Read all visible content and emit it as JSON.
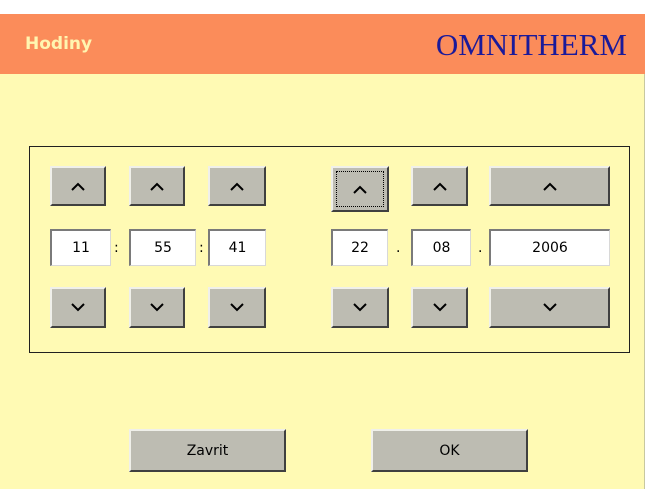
{
  "window": {
    "title": "Hodiny",
    "brand": "OMNITHERM"
  },
  "time": {
    "hours": "11",
    "minutes": "55",
    "seconds": "41",
    "separator": ":"
  },
  "date": {
    "day": "22",
    "month": "08",
    "year": "2006",
    "separator": "."
  },
  "icons": {
    "up": "chevron-up-icon",
    "down": "chevron-down-icon"
  },
  "buttons": {
    "close_label": "Zavrit",
    "ok_label": "OK"
  },
  "colors": {
    "background": "#fffab4",
    "header": "#fb8c5a",
    "title_text": "#fff5b0",
    "brand_text": "#1a1a9a",
    "button_face": "#bdbcb2"
  }
}
